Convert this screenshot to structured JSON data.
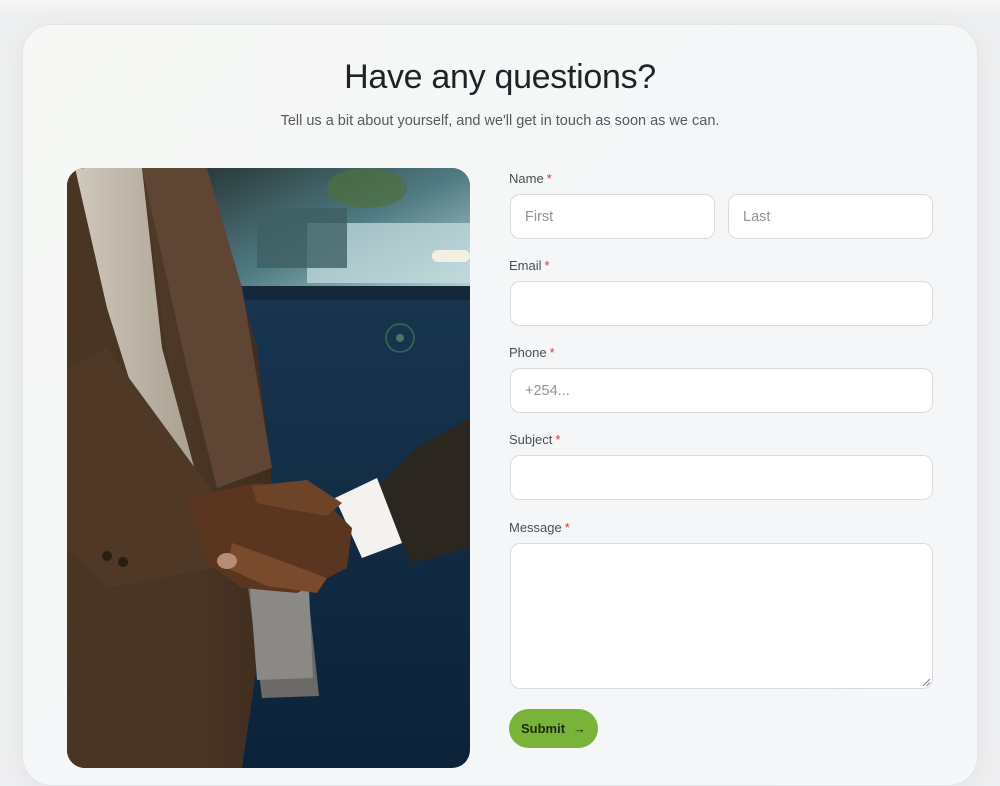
{
  "header": {
    "title": "Have any questions?",
    "subtitle": "Tell us a bit about yourself, and we'll get in touch as soon as we can."
  },
  "form": {
    "name": {
      "label": "Name",
      "required_mark": "*",
      "first_placeholder": "First",
      "last_placeholder": "Last"
    },
    "email": {
      "label": "Email",
      "required_mark": "*",
      "placeholder": ""
    },
    "phone": {
      "label": "Phone",
      "required_mark": "*",
      "placeholder": "+254..."
    },
    "subject": {
      "label": "Subject",
      "required_mark": "*",
      "placeholder": ""
    },
    "message": {
      "label": "Message",
      "required_mark": "*",
      "placeholder": ""
    },
    "submit": {
      "label": "Submit",
      "icon": "arrow-right-icon",
      "color": "#7ab33a"
    }
  },
  "image": {
    "subject": "handshake-photo"
  },
  "colors": {
    "accent": "#7ab33a",
    "required": "#d23a3a",
    "title": "#1f2327"
  }
}
